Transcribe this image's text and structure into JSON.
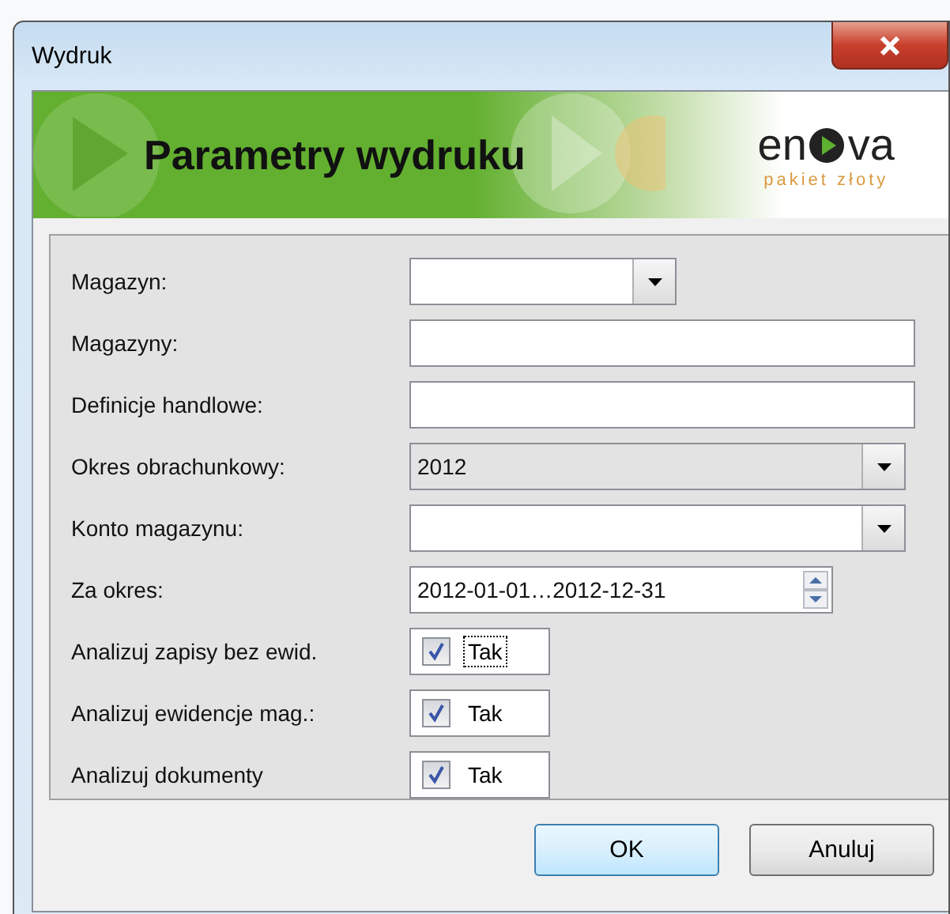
{
  "window": {
    "title": "Wydruk"
  },
  "banner": {
    "title": "Parametry wydruku",
    "logo": {
      "left": "en",
      "right": "va",
      "tagline": "pakiet złoty"
    }
  },
  "fields": [
    {
      "label": "Magazyn:",
      "kind": "combo",
      "short": true,
      "disabled": false
    },
    {
      "label": "Magazyny:",
      "kind": "text"
    },
    {
      "label": "Definicje handlowe:",
      "kind": "text"
    },
    {
      "label": "Okres obrachunkowy:",
      "kind": "combo",
      "short": false,
      "disabled": true,
      "value": "2012"
    },
    {
      "label": "Konto magazynu:",
      "kind": "combo",
      "short": false,
      "disabled": false
    },
    {
      "label": "Za okres:",
      "kind": "spinner",
      "value": "2012-01-01…2012-12-31"
    },
    {
      "label": "Analizuj zapisy bez ewid.",
      "kind": "checkbox",
      "checked": true,
      "focused": true,
      "text": "Tak"
    },
    {
      "label": "Analizuj ewidencje mag.:",
      "kind": "checkbox",
      "checked": true,
      "focused": false,
      "text": "Tak"
    },
    {
      "label": "Analizuj dokumenty",
      "kind": "checkbox",
      "checked": true,
      "focused": false,
      "text": "Tak"
    }
  ],
  "buttons": [
    {
      "label": "OK",
      "default": true
    },
    {
      "label": "Anuluj",
      "default": false
    }
  ]
}
